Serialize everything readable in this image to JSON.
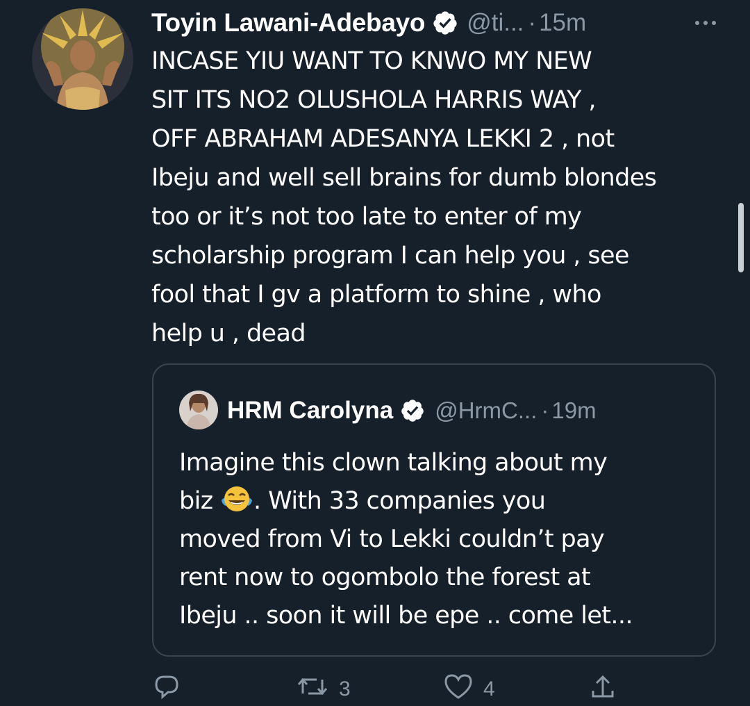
{
  "tweet": {
    "author": {
      "display_name": "Toyin Lawani-Adebayo",
      "handle": "@ti...",
      "separator": "·",
      "timestamp": "15m",
      "verified": true,
      "avatar_icon": "avatar-image"
    },
    "text_lines": [
      "INCASE YIU WANT TO KNWO MY NEW",
      "SIT ITS NO2 OLUSHOLA HARRIS WAY ,",
      "OFF ABRAHAM ADESANYA LEKKI 2 , not",
      "Ibeju and well sell brains for dumb blondes",
      "too or it’s not too late to enter of my",
      "scholarship program I can help you , see",
      "fool that I gv a platform to shine , who",
      "help u , dead"
    ],
    "quoted": {
      "display_name": "HRM Carolyna",
      "handle": "@HrmC...",
      "separator": "·",
      "timestamp": "19m",
      "verified": true,
      "line1": "Imagine this clown talking about my",
      "line2_before_emoji": "biz ",
      "line2_emoji": "face-with-tears-of-joy",
      "line2_after_emoji": ". With 33 companies you",
      "line3": "moved from Vi to Lekki couldn’t pay",
      "line4": "rent now to ogombolo the forest at",
      "line5": "Ibeju .. soon it will be epe .. come let..."
    },
    "actions": {
      "reply_count": "",
      "retweet_count": "3",
      "like_count": "4",
      "share_count": ""
    }
  },
  "colors": {
    "background": "#15202b",
    "text": "#ffffff",
    "secondary_text": "#8b98a5",
    "border": "#38444d",
    "verified_badge": "#ffffff"
  }
}
